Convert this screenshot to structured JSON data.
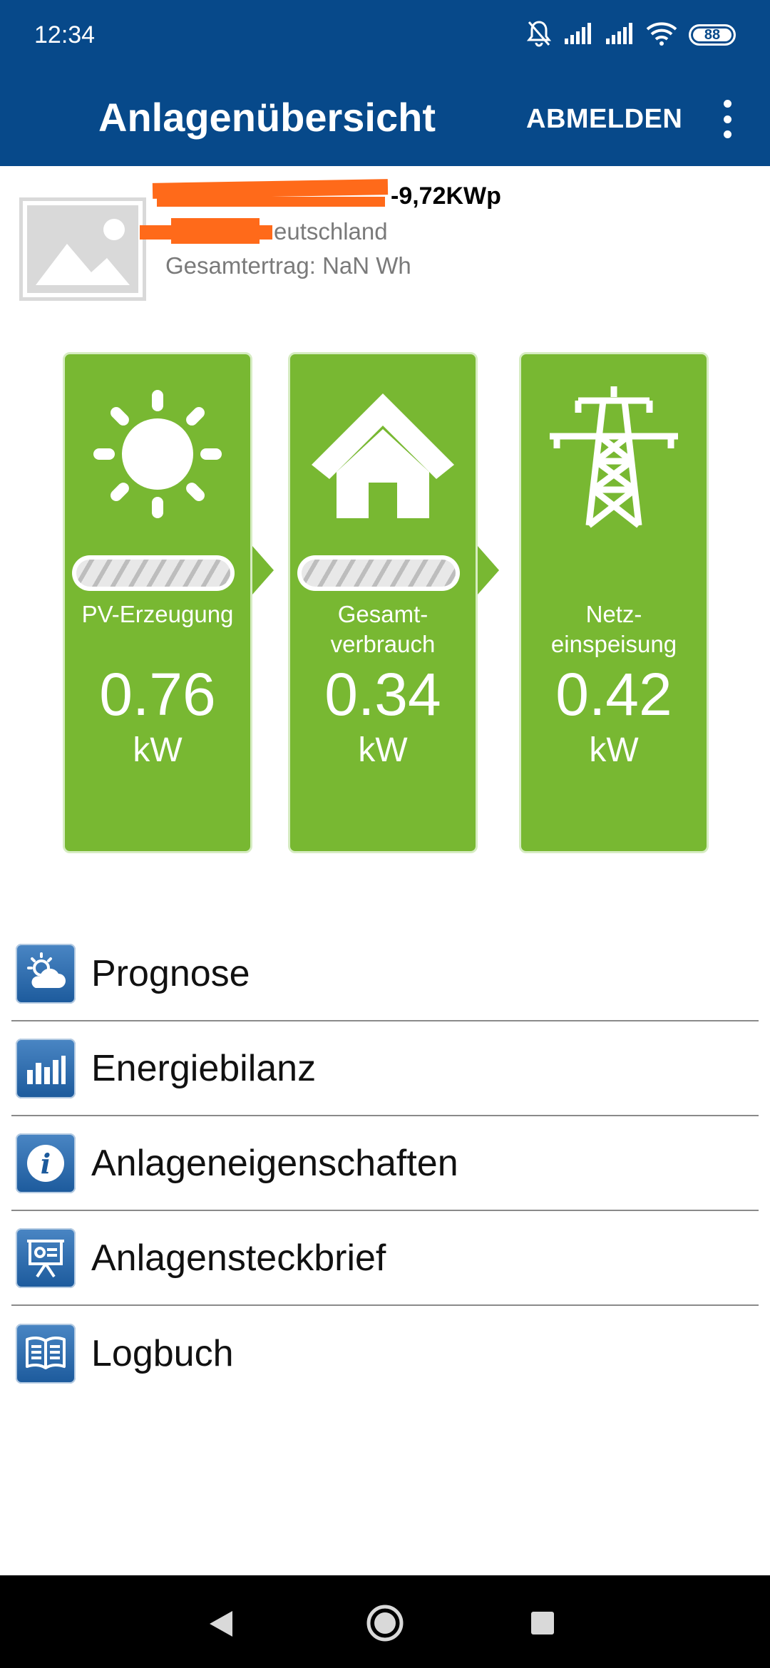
{
  "status_bar": {
    "time": "12:34",
    "battery": "88",
    "icons": [
      "bell-off-icon",
      "signal-icon",
      "signal-icon",
      "wifi-icon",
      "battery-icon"
    ]
  },
  "header": {
    "title": "Anlagenübersicht",
    "logout_label": "ABMELDEN",
    "menu_icon": "more-vert-icon"
  },
  "plant": {
    "name_suffix": "-9,72KWp",
    "country_suffix": "eutschland",
    "total_yield": "Gesamtertrag: NaN Wh",
    "image_icon": "image-placeholder-icon"
  },
  "flow": [
    {
      "icon": "sun-icon",
      "label_1": "PV-Erzeugung",
      "label_2": "",
      "value": "0.76",
      "unit": "kW"
    },
    {
      "icon": "house-icon",
      "label_1": "Gesamt-",
      "label_2": "verbrauch",
      "value": "0.34",
      "unit": "kW"
    },
    {
      "icon": "power-pylon-icon",
      "label_1": "Netz-",
      "label_2": "einspeisung",
      "value": "0.42",
      "unit": "kW"
    }
  ],
  "menu": [
    {
      "label": "Prognose",
      "icon": "weather-forecast-icon"
    },
    {
      "label": "Energiebilanz",
      "icon": "bar-chart-icon"
    },
    {
      "label": "Anlageneigenschaften",
      "icon": "info-icon"
    },
    {
      "label": "Anlagensteckbrief",
      "icon": "presentation-icon"
    },
    {
      "label": "Logbuch",
      "icon": "book-icon"
    }
  ],
  "colors": {
    "appbar": "#07498a",
    "tile_green": "#78b832",
    "redaction": "#ff6a1a",
    "menu_icon_blue": "#1c5a9c"
  }
}
